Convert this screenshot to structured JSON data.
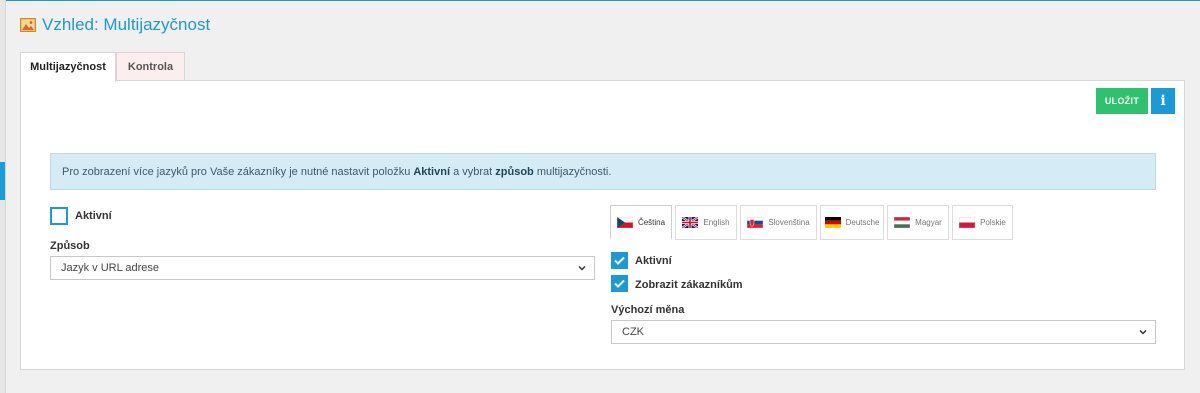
{
  "page": {
    "title": "Vzhled: Multijazyčnost"
  },
  "tabs": [
    {
      "label": "Multijazyčnost",
      "active": true
    },
    {
      "label": "Kontrola",
      "active": false
    }
  ],
  "toolbar": {
    "save_label": "ULOŽIT",
    "info_label": "i"
  },
  "alert": {
    "text_before": "Pro zobrazení více jazyků pro Vaše zákazníky je nutné nastavit položku ",
    "bold1": "Aktivní",
    "text_middle": " a vybrat ",
    "bold2": "způsob",
    "text_after": " multijazyčnosti."
  },
  "left_form": {
    "active_label": "Aktivní",
    "active_checked": false,
    "method_label": "Způsob",
    "method_value": "Jazyk v URL adrese"
  },
  "languages": [
    {
      "label": "Čeština",
      "flag": "flag-cz-icon",
      "active": true
    },
    {
      "label": "English",
      "flag": "flag-uk-icon",
      "active": false
    },
    {
      "label": "Slovenština",
      "flag": "flag-sk-icon",
      "active": false
    },
    {
      "label": "Deutsche",
      "flag": "flag-de-icon",
      "active": false
    },
    {
      "label": "Magyar",
      "flag": "flag-hu-icon",
      "active": false
    },
    {
      "label": "Polskie",
      "flag": "flag-pl-icon",
      "active": false
    }
  ],
  "right_form": {
    "active_label": "Aktivní",
    "active_checked": true,
    "show_label": "Zobrazit zákazníkům",
    "show_checked": true,
    "currency_label": "Výchozí měna",
    "currency_value": "CZK"
  },
  "colors": {
    "accent": "#1a9ad6",
    "save": "#2ec26e",
    "alert_bg": "#d5ecf6"
  }
}
